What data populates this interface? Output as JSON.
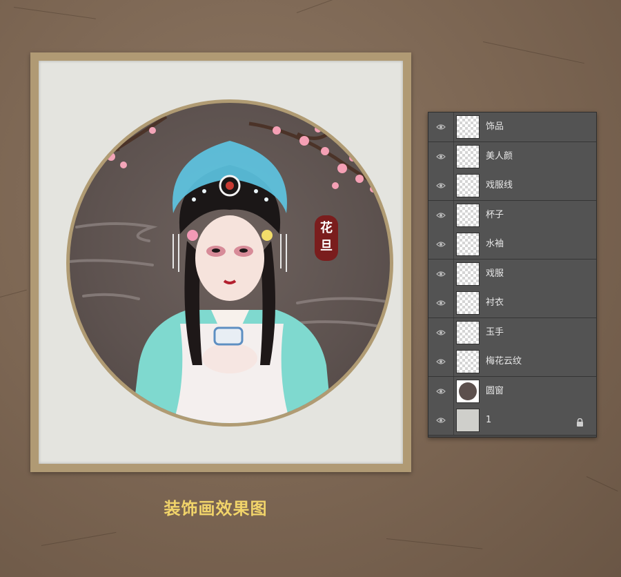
{
  "artwork": {
    "badge_text": "花旦",
    "caption": "装饰画效果图"
  },
  "layers_panel": {
    "layers": [
      {
        "name": "饰品",
        "thumb": "transparent",
        "visible": true,
        "locked": false
      },
      {
        "name": "美人颜",
        "thumb": "transparent",
        "visible": true,
        "locked": false
      },
      {
        "name": "戏服线",
        "thumb": "transparent",
        "visible": true,
        "locked": false
      },
      {
        "name": "杯子",
        "thumb": "transparent",
        "visible": true,
        "locked": false
      },
      {
        "name": "水袖",
        "thumb": "transparent",
        "visible": true,
        "locked": false
      },
      {
        "name": "戏服",
        "thumb": "transparent",
        "visible": true,
        "locked": false
      },
      {
        "name": "衬衣",
        "thumb": "transparent",
        "visible": true,
        "locked": false
      },
      {
        "name": "玉手",
        "thumb": "transparent",
        "visible": true,
        "locked": false
      },
      {
        "name": "梅花云纹",
        "thumb": "transparent",
        "visible": true,
        "locked": false
      },
      {
        "name": "圆窗",
        "thumb": "dark",
        "visible": true,
        "locked": false
      },
      {
        "name": "1",
        "thumb": "solid",
        "visible": true,
        "locked": true
      }
    ]
  },
  "colors": {
    "caption": "#f1d46a",
    "panel_bg": "#535353",
    "frame": "#b09a74",
    "badge": "#7a1d1d"
  }
}
